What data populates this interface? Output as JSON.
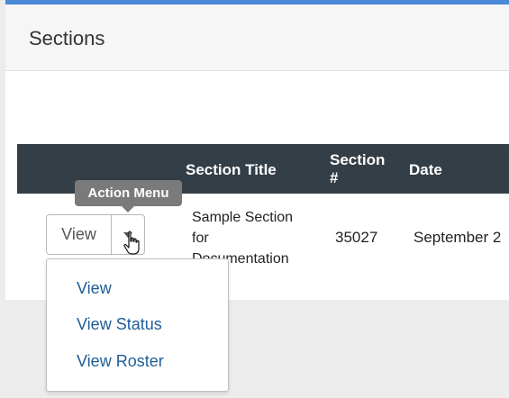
{
  "page": {
    "title": "Sections",
    "accent_color": "#4a8ad6",
    "header_bg": "#343e46"
  },
  "table": {
    "columns": [
      "",
      "Section Title",
      "Section #",
      "Date"
    ],
    "rows": [
      {
        "action_label": "View",
        "title": "Sample Section for Documentation",
        "number": "35027",
        "date": "September 2"
      }
    ]
  },
  "tooltip": {
    "text": "Action Menu"
  },
  "action_menu": {
    "items": [
      "View",
      "View Status",
      "View Roster"
    ],
    "link_color": "#1f5d97"
  }
}
